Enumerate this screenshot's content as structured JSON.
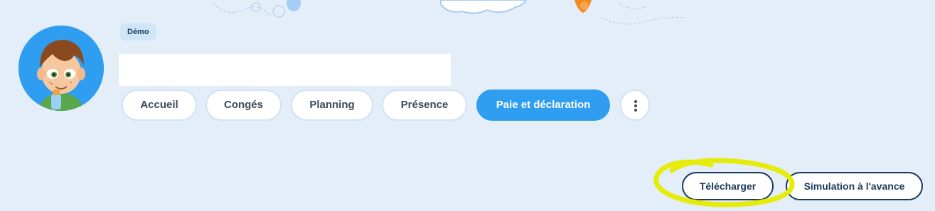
{
  "brand": {
    "accent": "#2f9ef0",
    "background": "#e3eef8",
    "text_dark": "#1b3a5c",
    "highlight": "#e6ec0a"
  },
  "header": {
    "avatar_icon": "child-avatar-icon",
    "badge": "Démo"
  },
  "nav": {
    "tabs": [
      {
        "label": "Accueil",
        "active": false
      },
      {
        "label": "Congés",
        "active": false
      },
      {
        "label": "Planning",
        "active": false
      },
      {
        "label": "Présence",
        "active": false
      },
      {
        "label": "Paie et déclaration",
        "active": true
      }
    ],
    "more_icon": "more-vertical-icon"
  },
  "actions": {
    "download_label": "Télécharger",
    "simulation_label": "Simulation à l'avance"
  }
}
